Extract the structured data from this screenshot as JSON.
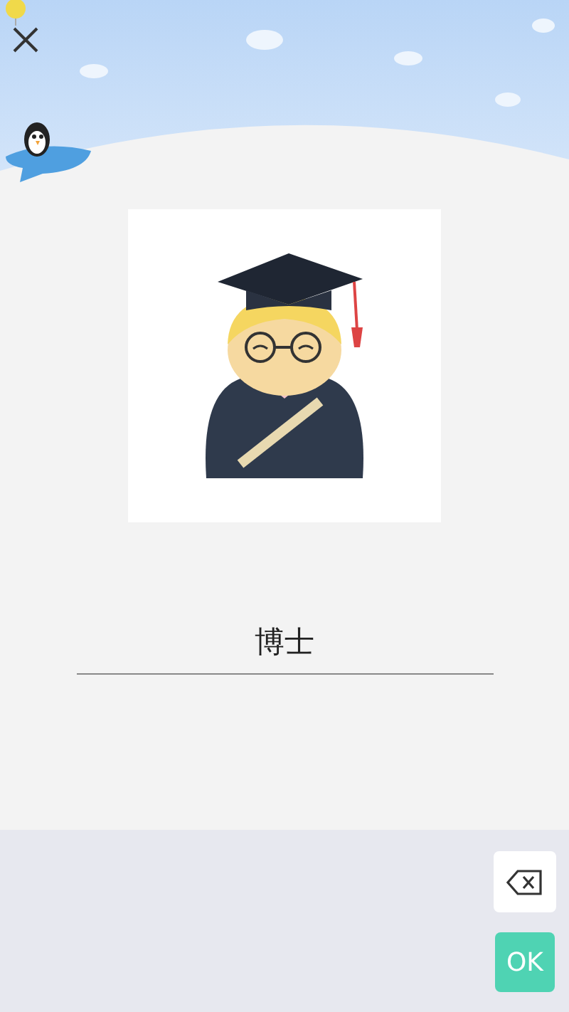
{
  "answer": {
    "value": "博士"
  },
  "keyboard": {
    "confirm_label": "OK"
  }
}
